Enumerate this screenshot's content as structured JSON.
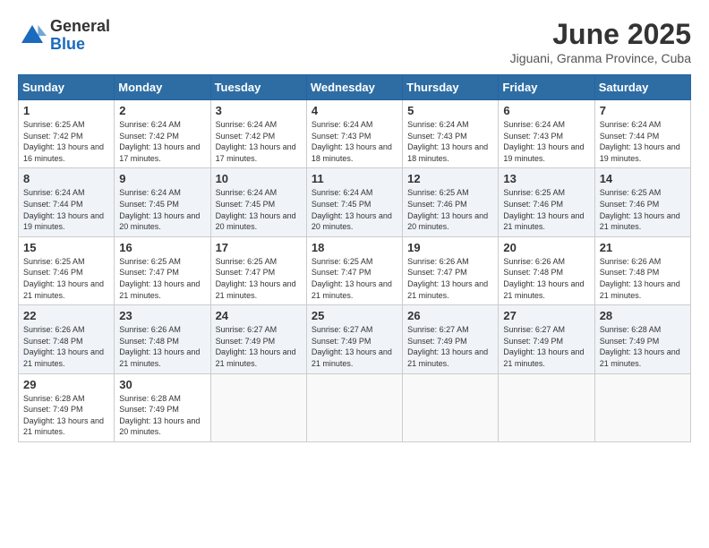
{
  "logo": {
    "general": "General",
    "blue": "Blue"
  },
  "title": "June 2025",
  "subtitle": "Jiguani, Granma Province, Cuba",
  "days_of_week": [
    "Sunday",
    "Monday",
    "Tuesday",
    "Wednesday",
    "Thursday",
    "Friday",
    "Saturday"
  ],
  "weeks": [
    [
      {
        "day": "1",
        "sunrise": "6:25 AM",
        "sunset": "7:42 PM",
        "daylight": "13 hours and 16 minutes."
      },
      {
        "day": "2",
        "sunrise": "6:24 AM",
        "sunset": "7:42 PM",
        "daylight": "13 hours and 17 minutes."
      },
      {
        "day": "3",
        "sunrise": "6:24 AM",
        "sunset": "7:42 PM",
        "daylight": "13 hours and 17 minutes."
      },
      {
        "day": "4",
        "sunrise": "6:24 AM",
        "sunset": "7:43 PM",
        "daylight": "13 hours and 18 minutes."
      },
      {
        "day": "5",
        "sunrise": "6:24 AM",
        "sunset": "7:43 PM",
        "daylight": "13 hours and 18 minutes."
      },
      {
        "day": "6",
        "sunrise": "6:24 AM",
        "sunset": "7:43 PM",
        "daylight": "13 hours and 19 minutes."
      },
      {
        "day": "7",
        "sunrise": "6:24 AM",
        "sunset": "7:44 PM",
        "daylight": "13 hours and 19 minutes."
      }
    ],
    [
      {
        "day": "8",
        "sunrise": "6:24 AM",
        "sunset": "7:44 PM",
        "daylight": "13 hours and 19 minutes."
      },
      {
        "day": "9",
        "sunrise": "6:24 AM",
        "sunset": "7:45 PM",
        "daylight": "13 hours and 20 minutes."
      },
      {
        "day": "10",
        "sunrise": "6:24 AM",
        "sunset": "7:45 PM",
        "daylight": "13 hours and 20 minutes."
      },
      {
        "day": "11",
        "sunrise": "6:24 AM",
        "sunset": "7:45 PM",
        "daylight": "13 hours and 20 minutes."
      },
      {
        "day": "12",
        "sunrise": "6:25 AM",
        "sunset": "7:46 PM",
        "daylight": "13 hours and 20 minutes."
      },
      {
        "day": "13",
        "sunrise": "6:25 AM",
        "sunset": "7:46 PM",
        "daylight": "13 hours and 21 minutes."
      },
      {
        "day": "14",
        "sunrise": "6:25 AM",
        "sunset": "7:46 PM",
        "daylight": "13 hours and 21 minutes."
      }
    ],
    [
      {
        "day": "15",
        "sunrise": "6:25 AM",
        "sunset": "7:46 PM",
        "daylight": "13 hours and 21 minutes."
      },
      {
        "day": "16",
        "sunrise": "6:25 AM",
        "sunset": "7:47 PM",
        "daylight": "13 hours and 21 minutes."
      },
      {
        "day": "17",
        "sunrise": "6:25 AM",
        "sunset": "7:47 PM",
        "daylight": "13 hours and 21 minutes."
      },
      {
        "day": "18",
        "sunrise": "6:25 AM",
        "sunset": "7:47 PM",
        "daylight": "13 hours and 21 minutes."
      },
      {
        "day": "19",
        "sunrise": "6:26 AM",
        "sunset": "7:47 PM",
        "daylight": "13 hours and 21 minutes."
      },
      {
        "day": "20",
        "sunrise": "6:26 AM",
        "sunset": "7:48 PM",
        "daylight": "13 hours and 21 minutes."
      },
      {
        "day": "21",
        "sunrise": "6:26 AM",
        "sunset": "7:48 PM",
        "daylight": "13 hours and 21 minutes."
      }
    ],
    [
      {
        "day": "22",
        "sunrise": "6:26 AM",
        "sunset": "7:48 PM",
        "daylight": "13 hours and 21 minutes."
      },
      {
        "day": "23",
        "sunrise": "6:26 AM",
        "sunset": "7:48 PM",
        "daylight": "13 hours and 21 minutes."
      },
      {
        "day": "24",
        "sunrise": "6:27 AM",
        "sunset": "7:49 PM",
        "daylight": "13 hours and 21 minutes."
      },
      {
        "day": "25",
        "sunrise": "6:27 AM",
        "sunset": "7:49 PM",
        "daylight": "13 hours and 21 minutes."
      },
      {
        "day": "26",
        "sunrise": "6:27 AM",
        "sunset": "7:49 PM",
        "daylight": "13 hours and 21 minutes."
      },
      {
        "day": "27",
        "sunrise": "6:27 AM",
        "sunset": "7:49 PM",
        "daylight": "13 hours and 21 minutes."
      },
      {
        "day": "28",
        "sunrise": "6:28 AM",
        "sunset": "7:49 PM",
        "daylight": "13 hours and 21 minutes."
      }
    ],
    [
      {
        "day": "29",
        "sunrise": "6:28 AM",
        "sunset": "7:49 PM",
        "daylight": "13 hours and 21 minutes."
      },
      {
        "day": "30",
        "sunrise": "6:28 AM",
        "sunset": "7:49 PM",
        "daylight": "13 hours and 20 minutes."
      },
      null,
      null,
      null,
      null,
      null
    ]
  ],
  "labels": {
    "sunrise": "Sunrise:",
    "sunset": "Sunset:",
    "daylight": "Daylight:"
  }
}
